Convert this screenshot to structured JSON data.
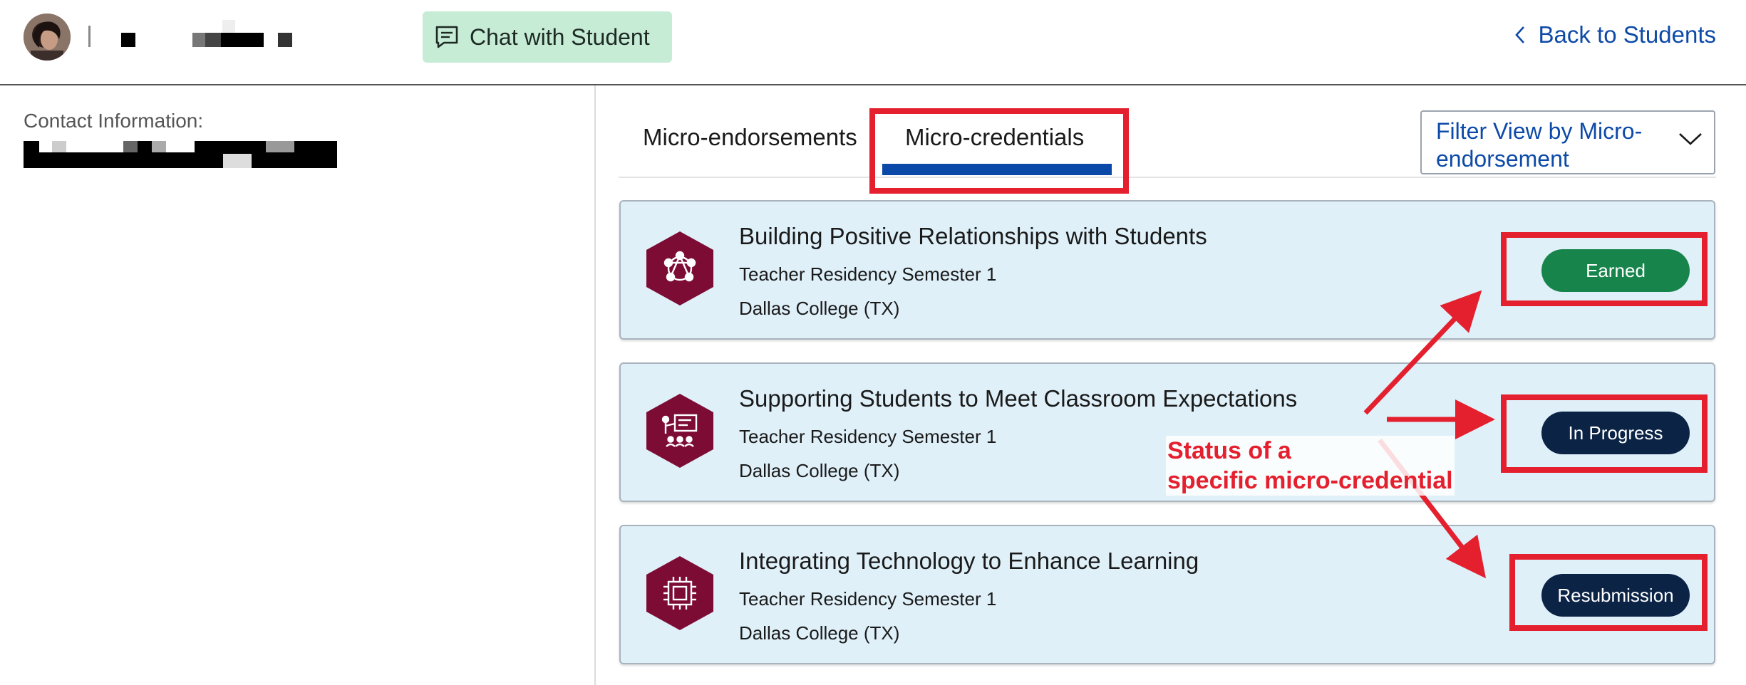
{
  "header": {
    "chat_button_label": "Chat with Student",
    "back_link_label": "Back to Students"
  },
  "left_panel": {
    "contact_label": "Contact Information:"
  },
  "tabs": [
    {
      "label": "Micro-endorsements",
      "active": false
    },
    {
      "label": "Micro-credentials",
      "active": true
    }
  ],
  "filter": {
    "label": "Filter View by Micro-endorsement"
  },
  "credentials": [
    {
      "title": "Building Positive Relationships with Students",
      "program": "Teacher Residency Semester 1",
      "institution": "Dallas College (TX)",
      "status": "Earned",
      "icon": "people-network-icon"
    },
    {
      "title": "Supporting Students to Meet Classroom Expectations",
      "program": "Teacher Residency Semester 1",
      "institution": "Dallas College (TX)",
      "status": "In Progress",
      "icon": "classroom-presentation-icon"
    },
    {
      "title": "Integrating Technology to Enhance Learning",
      "program": "Teacher Residency Semester 1",
      "institution": "Dallas College (TX)",
      "status": "Resubmission",
      "icon": "microchip-icon"
    }
  ],
  "annotation": {
    "line1": "Status of a",
    "line2": "specific micro-credential"
  },
  "colors": {
    "accent_blue": "#0b49a8",
    "chat_bg": "#c7ecd6",
    "card_bg": "#dff0f9",
    "hex_maroon": "#7d0c34",
    "earned_green": "#17854b",
    "navy": "#0b2446",
    "annotation_red": "#e4202f"
  }
}
